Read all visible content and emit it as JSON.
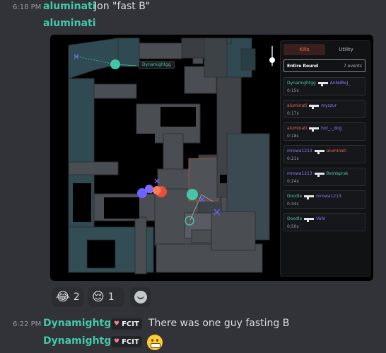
{
  "message1": {
    "time": "6:18 PM",
    "author": "aluminati",
    "text": "Jon \"fast B\""
  },
  "message2": {
    "author": "aluminati"
  },
  "embed": {
    "map_label": "Dynamightgg",
    "tabs": [
      "Kills",
      "Utility"
    ],
    "round_label": "Entire Round",
    "event_count": "7 events",
    "kills": [
      {
        "killer": "Dynamightgg",
        "victim": "AnNdReJ_",
        "time": "0:15s",
        "killer_color": "#44c7a8",
        "victim_color": "#8a7cff"
      },
      {
        "killer": "aluminati",
        "victim": "myszur",
        "time": "0:17s",
        "killer_color": "#f0645a",
        "victim_color": "#8a7cff"
      },
      {
        "killer": "aluminati",
        "victim": "hot_-_dog",
        "time": "0:18s",
        "killer_color": "#f0645a",
        "victim_color": "#8a7cff"
      },
      {
        "killer": "mrowa1213",
        "victim": "aluminati",
        "time": "0:21s",
        "killer_color": "#8a7cff",
        "victim_color": "#f0645a"
      },
      {
        "killer": "mrowa1213",
        "victim": "BesYaprak",
        "time": "0:24s",
        "killer_color": "#8a7cff",
        "victim_color": "#44c7a8"
      },
      {
        "killer": "Doodle",
        "victim": "mrowa1213",
        "time": "0:44s",
        "killer_color": "#44c7a8",
        "victim_color": "#8a7cff"
      },
      {
        "killer": "Doodle",
        "victim": "VelV",
        "time": "0:50s",
        "killer_color": "#44c7a8",
        "victim_color": "#8a7cff"
      }
    ]
  },
  "reactions": [
    {
      "emoji": "😂",
      "count": "2"
    },
    {
      "emoji": "😌",
      "count": "1"
    }
  ],
  "message3": {
    "time": "6:22 PM",
    "author": "Dynamightgg",
    "badge": "FCIT",
    "text": "There was one guy fasting B"
  },
  "message4": {
    "author": "Dynamightgg",
    "badge": "FCIT"
  },
  "colors": {
    "background": "#313338",
    "author": "#44c7a8",
    "ct_team": "#44c7a8",
    "t_team": "#8a7cff",
    "highlight": "#f0645a"
  }
}
